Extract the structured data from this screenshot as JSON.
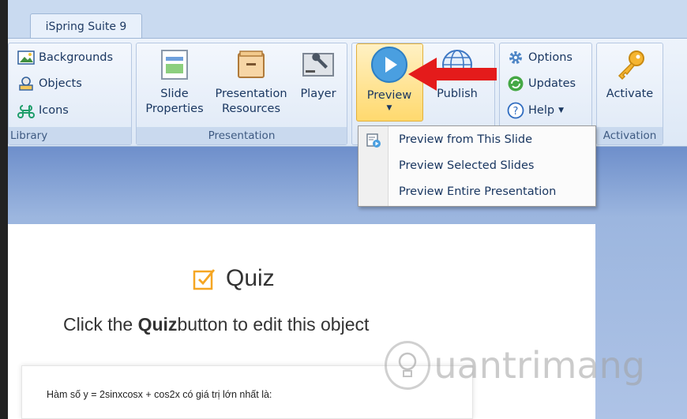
{
  "tab": {
    "label": "iSpring Suite 9"
  },
  "library": {
    "label": "Library",
    "items": [
      {
        "label": "Backgrounds",
        "icon": "backgrounds-icon"
      },
      {
        "label": "Objects",
        "icon": "objects-icon"
      },
      {
        "label": "Icons",
        "icon": "icons-icon"
      }
    ]
  },
  "presentation": {
    "label": "Presentation",
    "slide_properties": [
      "Slide",
      "Properties"
    ],
    "presentation_resources": [
      "Presentation",
      "Resources"
    ],
    "player": "Player"
  },
  "publish_group": {
    "preview": "Preview",
    "publish": "Publish"
  },
  "options_group": {
    "options": "Options",
    "updates": "Updates",
    "help": "Help"
  },
  "activation": {
    "label": "Activation",
    "activate": "Activate"
  },
  "preview_menu": {
    "items": [
      "Preview from This Slide",
      "Preview Selected Slides",
      "Preview Entire Presentation"
    ]
  },
  "slide": {
    "title": "Quiz",
    "subtitle_before": "Click the",
    "subtitle_bold": "Quiz",
    "subtitle_after": "button to edit this object",
    "question": "Hàm số y = 2sinxcosx + cos2x có giá trị lớn nhất là:"
  },
  "watermark": {
    "text": "uantrimang"
  },
  "colors": {
    "accent_orange": "#f5a623",
    "preview_blue": "#4a9fe0",
    "arrow_red": "#e41b1b",
    "ribbon_text": "#1a3761"
  }
}
